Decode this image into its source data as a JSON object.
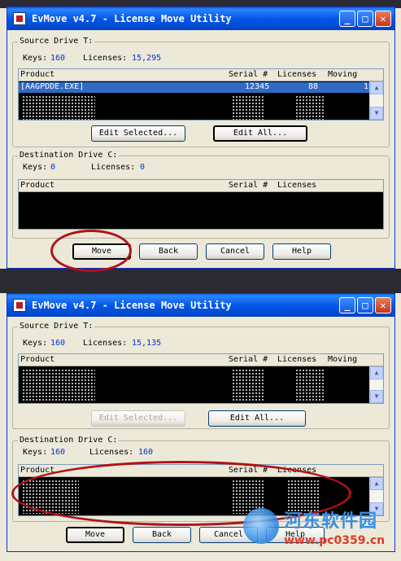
{
  "colors": {
    "title_bar": "#0055e5",
    "selection": "#316ac5",
    "value_text": "#0033cc",
    "annotation_circle": "#b11218",
    "window_bg": "#ece9d8"
  },
  "windows": [
    {
      "title": "EvMove v4.7 - License Move Utility",
      "source": {
        "legend": "Source Drive T:",
        "keys_label": "Keys:",
        "keys_value": "160",
        "licenses_label": "Licenses:",
        "licenses_value": "15,295",
        "columns": [
          "Product",
          "Serial #",
          "Licenses",
          "Moving"
        ],
        "rows": [
          {
            "product": "[AAGPDDE.EXE]",
            "serial": "12345",
            "licenses": "88",
            "moving": "1"
          }
        ],
        "edit_selected_label": "Edit Selected...",
        "edit_all_label": "Edit All..."
      },
      "destination": {
        "legend": "Destination Drive C:",
        "keys_label": "Keys:",
        "keys_value": "0",
        "licenses_label": "Licenses:",
        "licenses_value": "0",
        "columns": [
          "Product",
          "Serial #",
          "Licenses"
        ]
      },
      "buttons": {
        "move": "Move",
        "back": "Back",
        "cancel": "Cancel",
        "help": "Help"
      }
    },
    {
      "title": "EvMove v4.7 - License Move Utility",
      "source": {
        "legend": "Source Drive T:",
        "keys_label": "Keys:",
        "keys_value": "160",
        "licenses_label": "Licenses:",
        "licenses_value": "15,135",
        "columns": [
          "Product",
          "Serial #",
          "Licenses",
          "Moving"
        ],
        "edit_selected_label": "Edit Selected...",
        "edit_all_label": "Edit All..."
      },
      "destination": {
        "legend": "Destination Drive C:",
        "keys_label": "Keys:",
        "keys_value": "160",
        "licenses_label": "Licenses:",
        "licenses_value": "160",
        "columns": [
          "Product",
          "Serial #",
          "Licenses"
        ]
      },
      "buttons": {
        "move": "Move",
        "back": "Back",
        "cancel": "Cancel",
        "help": "Help"
      }
    }
  ],
  "watermark": {
    "name": "河东软件园",
    "url": "www.pc0359.cn"
  },
  "icons": [
    "app-icon",
    "minimize-icon",
    "maximize-icon",
    "close-icon",
    "scroll-up-icon",
    "scroll-down-icon"
  ]
}
